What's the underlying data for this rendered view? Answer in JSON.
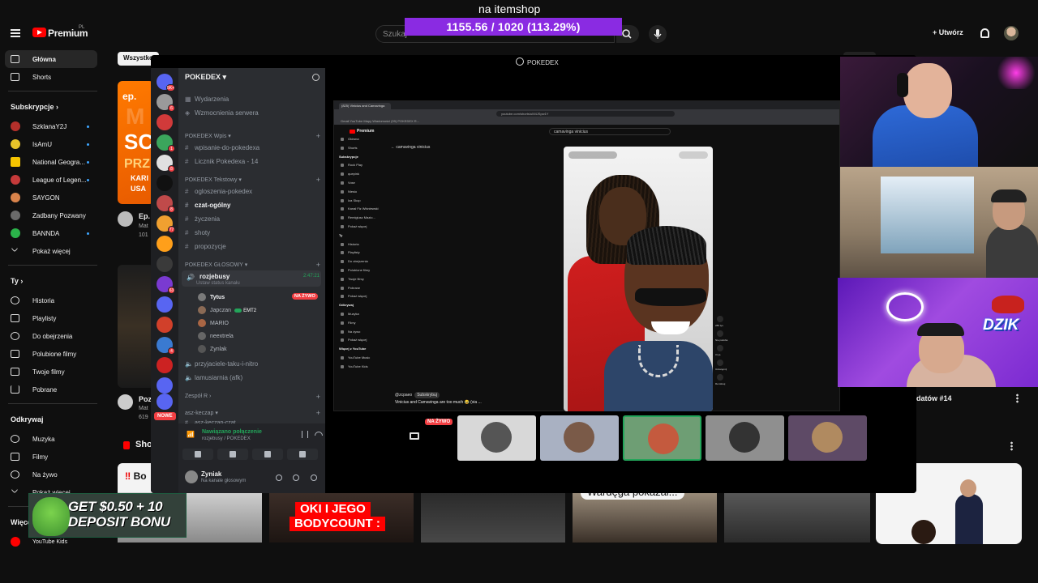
{
  "overlay": {
    "itemshop_label": "na itemshop",
    "goal_text": "1155.56 / 1020 (113.29%)",
    "goal_current": 1155.56,
    "goal_target": 1020,
    "goal_percent": 113.29,
    "goal_color": "#8a2be2"
  },
  "youtube": {
    "logo": "Premium",
    "logo_country": "PL",
    "search_placeholder": "Szukaj",
    "create_label": "Utwórz",
    "sidebar": {
      "main": [
        {
          "label": "Główna",
          "icon": "home-icon",
          "active": true
        },
        {
          "label": "Shorts",
          "icon": "shorts-icon",
          "active": false
        }
      ],
      "subscriptions_header": "Subskrypcje",
      "subscriptions": [
        {
          "label": "SzklanaY2J",
          "color": "#b4302b"
        },
        {
          "label": "IsAmU",
          "color": "#e8c32a"
        },
        {
          "label": "National Geogra...",
          "color": "#f5c400"
        },
        {
          "label": "League of Legen...",
          "color": "#c53a3a"
        },
        {
          "label": "SAYGON",
          "color": "#d9834b"
        },
        {
          "label": "Zadbany Pozwany",
          "color": "#6a6a6a"
        },
        {
          "label": "BANNDA",
          "color": "#2bb34a"
        }
      ],
      "show_more": "Pokaż więcej",
      "you_header": "Ty",
      "you_items": [
        {
          "label": "Historia",
          "icon": "history-icon"
        },
        {
          "label": "Playlisty",
          "icon": "playlist-icon"
        },
        {
          "label": "Do obejrzenia",
          "icon": "watch-later-icon"
        },
        {
          "label": "Polubione filmy",
          "icon": "like-icon"
        },
        {
          "label": "Twoje filmy",
          "icon": "your-videos-icon"
        },
        {
          "label": "Pobrane",
          "icon": "download-icon"
        }
      ],
      "explore_header": "Odkrywaj",
      "explore_items": [
        {
          "label": "Muzyka",
          "icon": "music-icon"
        },
        {
          "label": "Filmy",
          "icon": "film-icon"
        },
        {
          "label": "Na żywo",
          "icon": "live-icon"
        },
        {
          "label": "Pokaż więcej",
          "icon": "chevron-down-icon"
        }
      ],
      "more_header": "Więce",
      "bottom_item": "YouTube Kids"
    },
    "chip_all": "Wszystko",
    "video_left_1": {
      "title": "Ep.",
      "meta": "Mat",
      "views": "101",
      "thumb_text_1": "ep.",
      "thumb_text_2": "M",
      "thumb_text_3": "SC",
      "thumb_text_4": "PRZ",
      "thumb_text_5": "KARI",
      "thumb_text_6": "USA"
    },
    "video_left_2": {
      "title": "Poz",
      "meta": "Mat",
      "views": "619"
    },
    "shorts_header": "Sho",
    "right_video_title": "datów #14",
    "short_bo": "Bo",
    "short_oki_1": "OKI I JEGO",
    "short_oki_2": "BODYCOUNT :",
    "short_wardega": "Wardęga pokazał..."
  },
  "promo": {
    "line1": "GET $0.50 + 10",
    "line2": "DEPOSIT BONU"
  },
  "discord": {
    "window_title": "POKEDEX",
    "server_name": "POKEDEX",
    "server_badges": [
      "5K+",
      "6",
      "",
      "1",
      "8",
      "",
      "8",
      "77",
      "",
      "",
      "63",
      "",
      "",
      "4",
      "",
      "",
      ""
    ],
    "nowe_label": "NOWE",
    "top_channels": [
      {
        "label": "Wydarzenia"
      },
      {
        "label": "Wzmocnienia serwera"
      }
    ],
    "categories": [
      {
        "name": "POKEDEX Wpis",
        "channels": [
          "wpisanie-do-pokedexa",
          "Licznik Pokedexa - 14"
        ]
      },
      {
        "name": "POKEDEX Tekstowy",
        "channels": [
          "ogloszenia-pokedex",
          "czat-ogólny",
          "życzenia",
          "shoty",
          "propozycje"
        ]
      },
      {
        "name": "POKEDEX GŁOSOWY",
        "channels": []
      }
    ],
    "active_text_channel": "czat-ogólny",
    "voice_channel": {
      "name": "rozjebusy",
      "time": "2:47:21",
      "status": "Ustaw status kanału",
      "live_label": "NA ŻYWO",
      "users": [
        {
          "name": "Tytus",
          "color": "#7a7a7a"
        },
        {
          "name": "Japczan",
          "color": "#8a6a55",
          "badge": "EMT2"
        },
        {
          "name": "MARIO",
          "color": "#aa6644"
        },
        {
          "name": "neextrela",
          "color": "#666"
        },
        {
          "name": "Zynlak",
          "color": "#555"
        }
      ]
    },
    "other_voice": [
      "przyjaciele-taku-i-nitro",
      "lamusiarnia (afk)"
    ],
    "category_r": "Zespół R",
    "category_k": "asz-keczap",
    "channel_k": "asz-keczap-czat",
    "connection": {
      "status": "Nawiązano połączenie",
      "sub": "rozjebusy / POKEDEX"
    },
    "me": {
      "name": "Zyniak",
      "status": "Na kanale głosowym"
    },
    "stream": {
      "nested_tab": "(825) Vinicius and Camavinga a...",
      "nested_url": "youtube.com/shorts/uM4JSpw1Y",
      "bookmarks": "Gmail   YouTube   Mapy   Wiadomości   (99) POKEDEX R...",
      "nested_logo": "Premium",
      "nested_search": "camavinga vinicius",
      "back_label": "camavinga vinicius",
      "nested_sidebar": [
        "Główna",
        "Shorts",
        "Subskrypcje",
        "Rock Play",
        "quepink",
        "Vose",
        "Niesio",
        "Iza Skop",
        "Kanał Fiz Wiśniewski",
        "Remigiusz Mazio...",
        "Pokaż więcej",
        "Ty",
        "Historia",
        "Playlisty",
        "Do obejrzenia",
        "Polubione filmy",
        "Twoje filmy",
        "Pobrane",
        "Pokaż więcej",
        "Odkrywaj",
        "Muzyka",
        "Filmy",
        "Na żywo",
        "Pokaż więcej",
        "Więcej z YouTube",
        "YouTube Music",
        "YouTube Kids"
      ],
      "comment_user": "@zcpaeo",
      "comment_tag": "Subskrybuj",
      "comment_text": "Vinicius and Camavinga are too much 😂 (via ...",
      "rail_labels": [
        "286 tys.",
        "Nie podoba",
        "3 tys.",
        "Udostępnij",
        "Remiksuj"
      ]
    },
    "strip_live": "NA ŻYWO",
    "strip_tiles": [
      {
        "bg": "#d8d8d8",
        "face": "#555"
      },
      {
        "bg": "#a9b1c2",
        "face": "#7a5a48"
      },
      {
        "bg": "#6e9e74",
        "face": "#c45a3e"
      },
      {
        "bg": "#8f8f8f",
        "face": "#333"
      },
      {
        "bg": "#5e4a66",
        "face": "#b08a60"
      }
    ]
  },
  "webcams": {
    "brand": "DZIK"
  }
}
